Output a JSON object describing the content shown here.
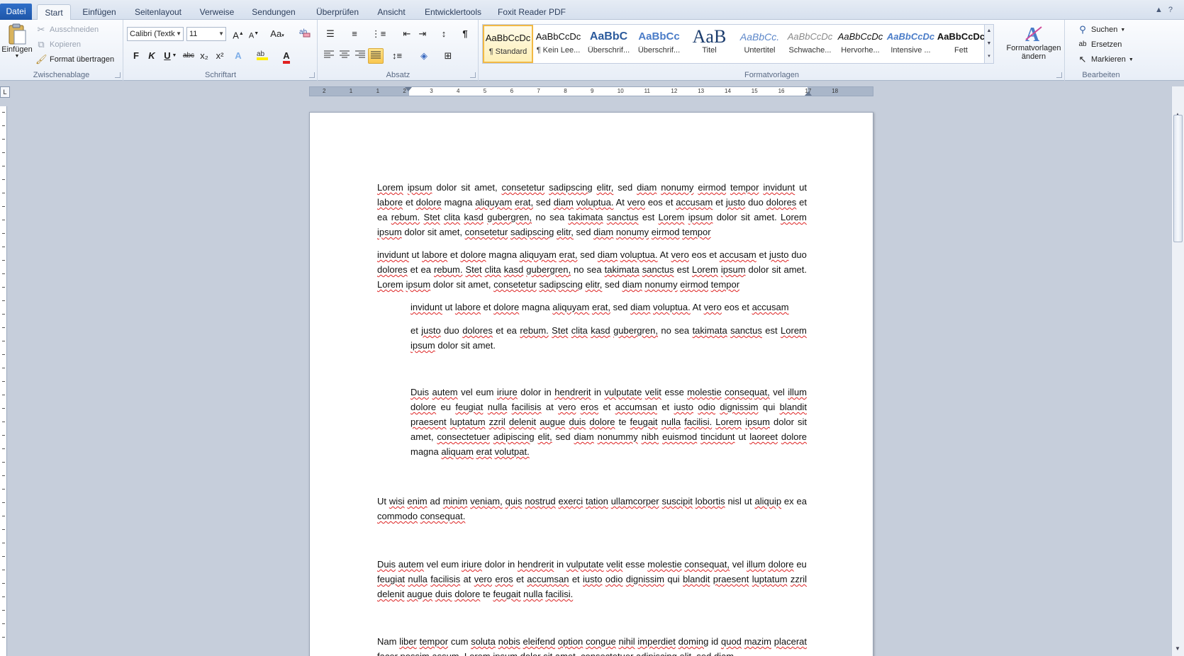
{
  "tabs": [
    "Datei",
    "Start",
    "Einfügen",
    "Seitenlayout",
    "Verweise",
    "Sendungen",
    "Überprüfen",
    "Ansicht",
    "Entwicklertools",
    "Foxit Reader PDF"
  ],
  "clipboard": {
    "paste_label": "Einfügen",
    "cut_label": "Ausschneiden",
    "copy_label": "Kopieren",
    "format_painter_label": "Format übertragen",
    "group_label": "Zwischenablage"
  },
  "font": {
    "family_value": "Calibri (Textk",
    "size_value": "11",
    "bold_label": "F",
    "italic_label": "K",
    "underline_label": "U",
    "strike_label": "abc",
    "sub_label": "x₂",
    "sup_label": "x²",
    "group_label": "Schriftart"
  },
  "paragraph": {
    "group_label": "Absatz"
  },
  "styles": {
    "group_label": "Formatvorlagen",
    "items": [
      {
        "sample": "AaBbCcDc",
        "name": "¶ Standard"
      },
      {
        "sample": "AaBbCcDc",
        "name": "¶ Kein Lee..."
      },
      {
        "sample": "AaBbC",
        "name": "Überschrif..."
      },
      {
        "sample": "AaBbCc",
        "name": "Überschrif..."
      },
      {
        "sample": "AaB",
        "name": "Titel"
      },
      {
        "sample": "AaBbCc.",
        "name": "Untertitel"
      },
      {
        "sample": "AaBbCcDc",
        "name": "Schwache..."
      },
      {
        "sample": "AaBbCcDc",
        "name": "Hervorhe..."
      },
      {
        "sample": "AaBbCcDc",
        "name": "Intensive ..."
      },
      {
        "sample": "AaBbCcDc",
        "name": "Fett"
      }
    ],
    "change_label_1": "Formatvorlagen",
    "change_label_2": "ändern"
  },
  "editing": {
    "group_label": "Bearbeiten",
    "find_label": "Suchen",
    "replace_label": "Ersetzen",
    "select_label": "Markieren"
  },
  "ruler": {
    "ticks": [
      "2",
      "1",
      "1",
      "2",
      "3",
      "4",
      "5",
      "6",
      "7",
      "8",
      "9",
      "10",
      "11",
      "12",
      "13",
      "14",
      "15",
      "16",
      "17",
      "18"
    ]
  },
  "document": {
    "paragraphs": [
      "Lorem ipsum dolor sit amet, consetetur sadipscing elitr, sed diam nonumy eirmod tempor invidunt ut labore et dolore magna aliquyam erat, sed diam voluptua. At vero eos et accusam et justo duo dolores et ea rebum. Stet clita kasd gubergren, no sea takimata sanctus est Lorem ipsum dolor sit amet. Lorem ipsum dolor sit amet, consetetur sadipscing elitr, sed diam nonumy eirmod tempor",
      "invidunt ut labore et dolore magna aliquyam erat, sed diam voluptua. At vero eos et accusam et justo duo dolores et ea rebum. Stet clita kasd gubergren, no sea takimata sanctus est Lorem ipsum dolor sit amet. Lorem ipsum dolor sit amet, consetetur sadipscing elitr, sed diam nonumy eirmod tempor",
      "invidunt ut labore et dolore magna aliquyam erat, sed diam voluptua. At vero eos et accusam",
      "et justo duo dolores et ea rebum. Stet clita kasd gubergren, no sea takimata sanctus est Lorem ipsum dolor sit amet.",
      "Duis autem vel eum iriure dolor in hendrerit in vulputate velit esse molestie consequat, vel illum dolore eu feugiat nulla facilisis at vero eros et accumsan et iusto odio dignissim qui blandit praesent luptatum zzril delenit augue duis dolore te feugait nulla facilisi. Lorem ipsum dolor sit amet, consectetuer adipiscing elit, sed diam nonummy nibh euismod tincidunt ut laoreet dolore magna aliquam erat volutpat.",
      "Ut wisi enim ad minim veniam, quis nostrud exerci tation ullamcorper suscipit lobortis nisl ut aliquip ex ea commodo consequat.",
      "Duis autem vel eum iriure dolor in hendrerit in vulputate velit esse molestie consequat, vel illum dolore eu feugiat nulla facilisis at vero eros et accumsan et iusto odio dignissim qui blandit praesent luptatum zzril delenit augue duis dolore te feugait nulla facilisi.",
      "Nam liber tempor cum soluta nobis eleifend option congue nihil imperdiet doming id quod mazim placerat facer possim assum. Lorem ipsum dolor sit amet, consectetuer adipiscing elit, sed diam"
    ]
  },
  "colors": {
    "file_tab": "#1e56a8",
    "selected_style_border": "#f2b944",
    "spell_underline": "#dd2222",
    "canvas": "#c6cedb"
  }
}
